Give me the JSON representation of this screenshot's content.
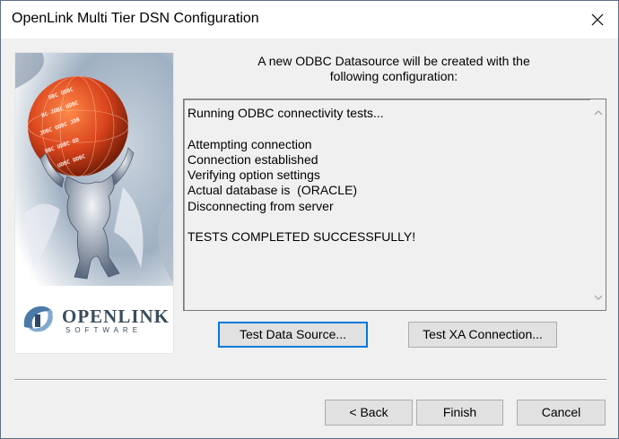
{
  "window": {
    "title": "OpenLink Multi Tier DSN Configuration",
    "close_icon": "close-icon"
  },
  "sidebar": {
    "image": "atlas-holding-globe-illustration",
    "logo_word": "OPENLINK",
    "logo_sub": "SOFTWARE"
  },
  "header": {
    "line1": "A new ODBC Datasource will be created with the",
    "line2": "following configuration:"
  },
  "results": {
    "text": "Running ODBC connectivity tests...\n\nAttempting connection\nConnection established\nVerifying option settings\nActual database is  (ORACLE)\nDisconnecting from server\n\nTESTS COMPLETED SUCCESSFULLY!"
  },
  "buttons": {
    "test_data_source": "Test Data Source...",
    "test_xa": "Test XA Connection...",
    "back": "< Back",
    "finish": "Finish",
    "cancel": "Cancel"
  },
  "colors": {
    "focus_border": "#0078d7",
    "button_face": "#e1e1e1",
    "dialog_bg": "#f0f0f0",
    "globe": "#d9441c",
    "logo_text": "#3a4d5a"
  }
}
